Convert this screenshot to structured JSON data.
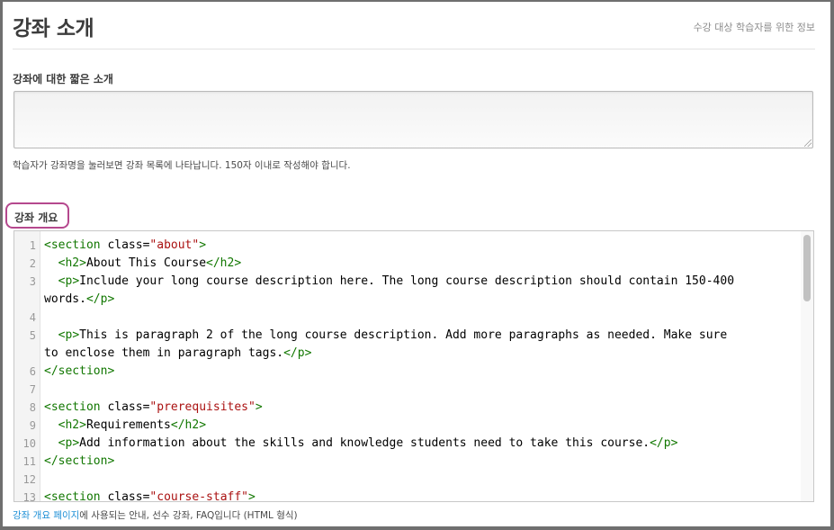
{
  "header": {
    "title": "강좌 소개",
    "subtitle": "수강 대상 학습자를 위한 정보"
  },
  "short_description": {
    "label": "강좌에 대한 짧은 소개",
    "value": "",
    "help": "학습자가 강좌명을 눌러보면 강좌 목록에 나타납니다. 150자 이내로 작성해야 합니다."
  },
  "overview": {
    "label": "강좌 개요",
    "help_link": "강좌 개요 페이지",
    "help_rest": "에 사용되는 안내, 선수 강좌, FAQ입니다 (HTML 형식)",
    "highlight_color": "#b5488e",
    "code_lines": [
      {
        "num": "1",
        "text": "<section class=\"about\">"
      },
      {
        "num": "2",
        "text": "  <h2>About This Course</h2>"
      },
      {
        "num": "3",
        "text": "  <p>Include your long course description here. The long course description should contain 150-400"
      },
      {
        "num": "",
        "text": "words.</p>"
      },
      {
        "num": "4",
        "text": ""
      },
      {
        "num": "5",
        "text": "  <p>This is paragraph 2 of the long course description. Add more paragraphs as needed. Make sure"
      },
      {
        "num": "",
        "text": "to enclose them in paragraph tags.</p>"
      },
      {
        "num": "6",
        "text": "</section>"
      },
      {
        "num": "7",
        "text": ""
      },
      {
        "num": "8",
        "text": "<section class=\"prerequisites\">"
      },
      {
        "num": "9",
        "text": "  <h2>Requirements</h2>"
      },
      {
        "num": "10",
        "text": "  <p>Add information about the skills and knowledge students need to take this course.</p>"
      },
      {
        "num": "11",
        "text": "</section>"
      },
      {
        "num": "12",
        "text": ""
      },
      {
        "num": "13",
        "text": "<section class=\"course-staff\">"
      }
    ]
  },
  "colors": {
    "tag": "#117700",
    "attribute": "#0000cc",
    "string": "#aa1111",
    "link": "#1d8fd6"
  }
}
